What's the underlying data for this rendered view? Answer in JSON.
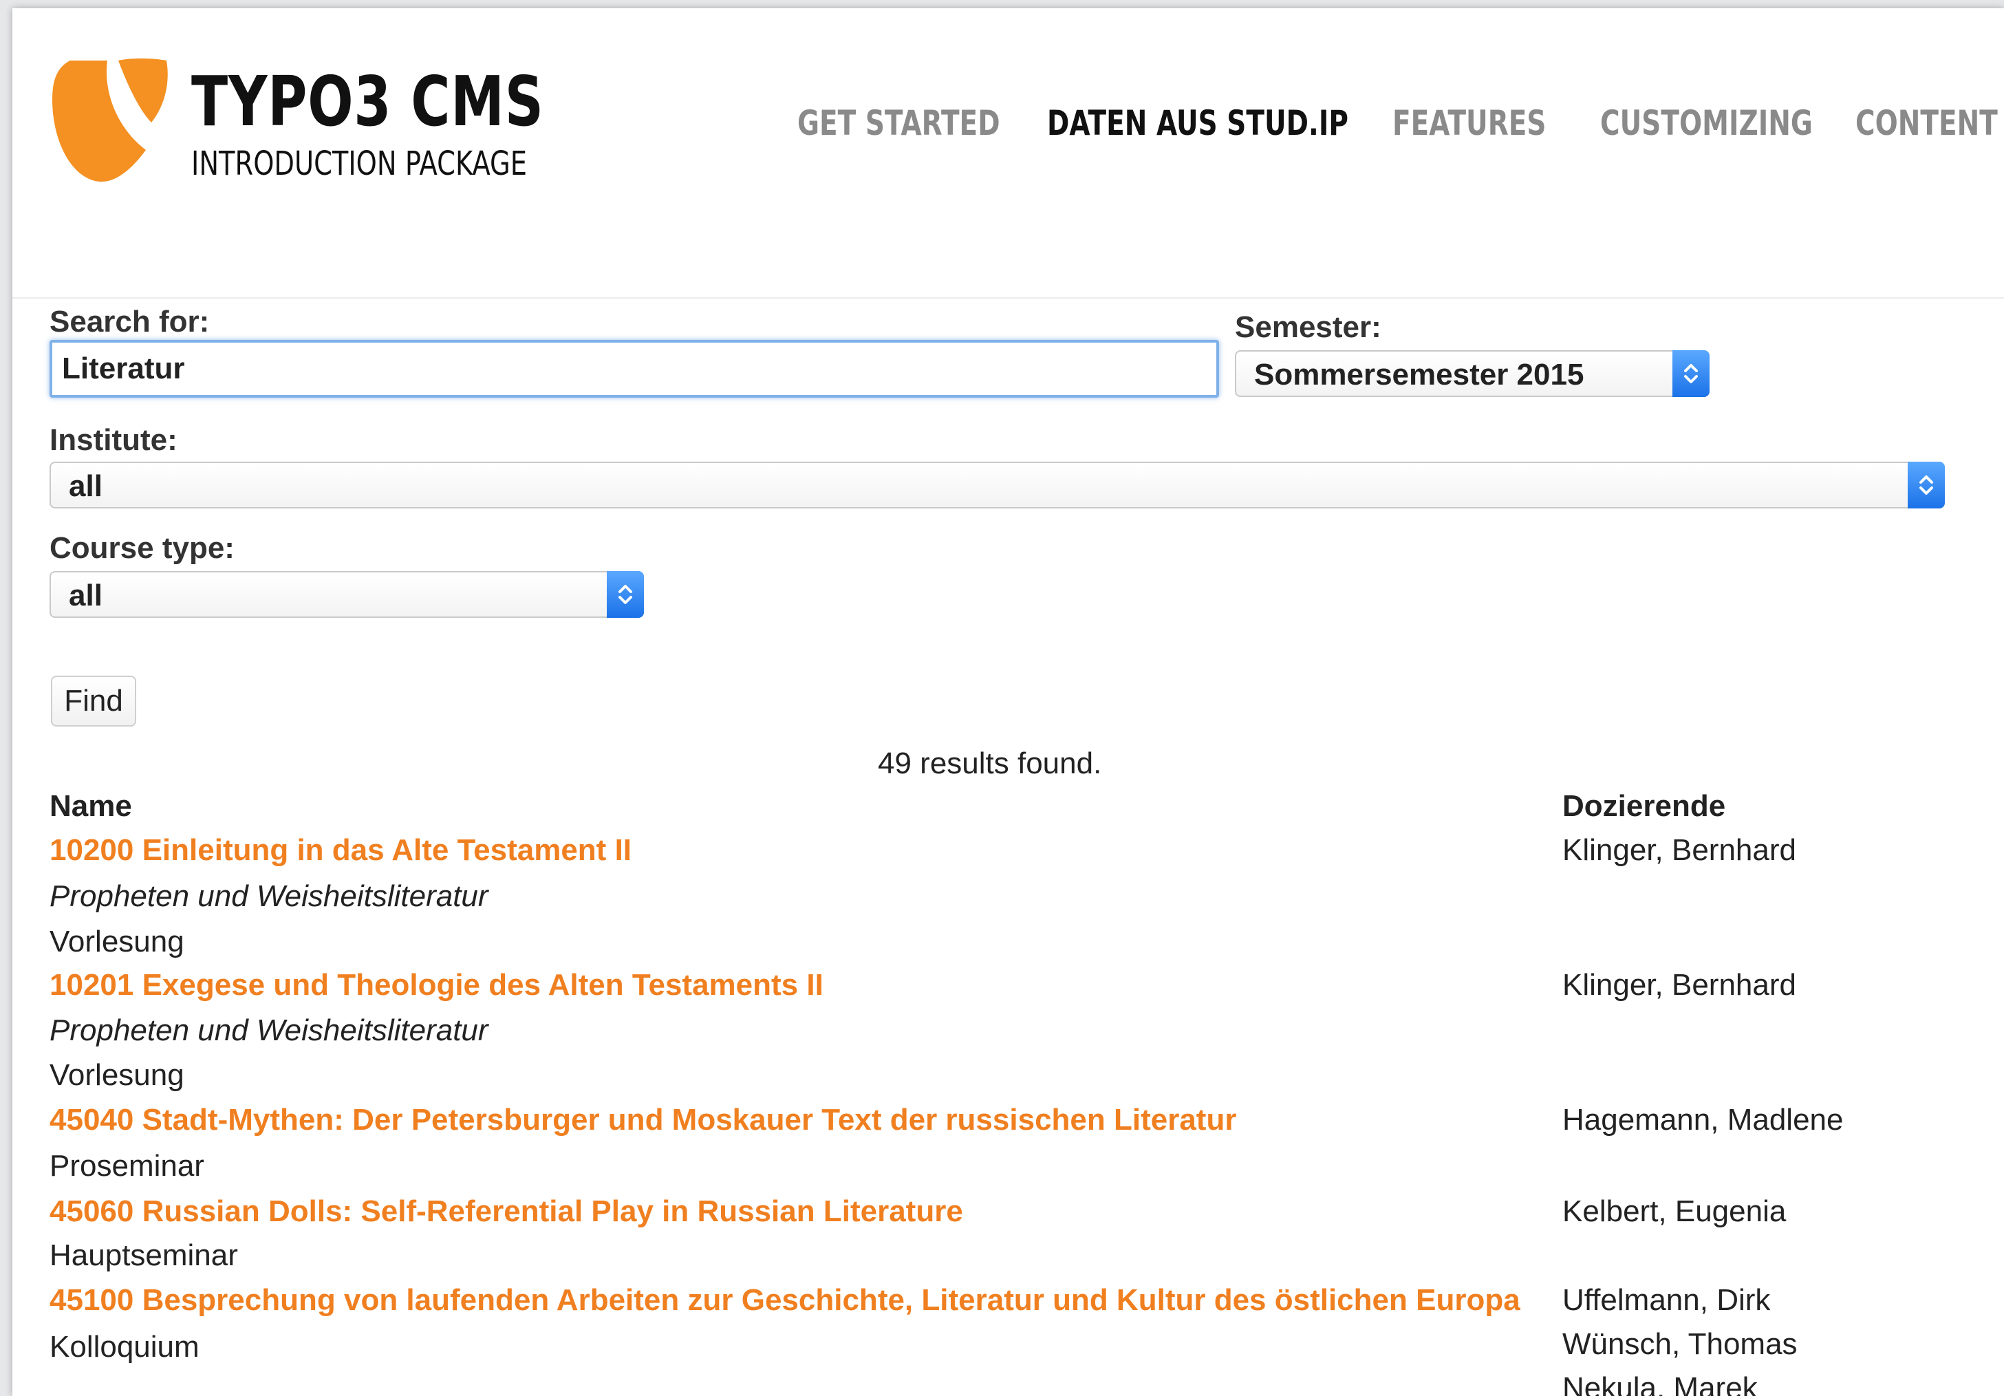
{
  "header": {
    "brand_name": "TYPO3 CMS",
    "brand_sub": "INTRODUCTION PACKAGE",
    "nav": [
      {
        "label": "GET STARTED"
      },
      {
        "label": "DATEN AUS STUD.IP"
      },
      {
        "label": "FEATURES"
      },
      {
        "label": "CUSTOMIZING"
      },
      {
        "label": "CONTENT E"
      }
    ],
    "active_nav": "DATEN AUS STUD.IP"
  },
  "form": {
    "search_label": "Search for:",
    "search_value": "Literatur",
    "semester_label": "Semester:",
    "semester_value": "Sommersemester 2015",
    "institute_label": "Institute:",
    "institute_value": "all",
    "course_type_label": "Course type:",
    "course_type_value": "all",
    "find_label": "Find"
  },
  "results": {
    "count_text": "49 results found.",
    "col_name": "Name",
    "col_lecturers": "Dozierende",
    "rows": [
      {
        "title": "10200 Einleitung in das Alte Testament II",
        "subtitle": "Propheten und Weisheitsliteratur",
        "type": "Vorlesung",
        "lecturers": [
          "Klinger, Bernhard"
        ]
      },
      {
        "title": "10201 Exegese und Theologie des Alten Testaments II",
        "subtitle": "Propheten und Weisheitsliteratur",
        "type": "Vorlesung",
        "lecturers": [
          "Klinger, Bernhard"
        ]
      },
      {
        "title": "45040 Stadt-Mythen: Der Petersburger und Moskauer Text der russischen Literatur",
        "subtitle": "",
        "type": "Proseminar",
        "lecturers": [
          "Hagemann, Madlene"
        ]
      },
      {
        "title": "45060 Russian Dolls: Self-Referential Play in Russian Literature",
        "subtitle": "",
        "type": "Hauptseminar",
        "lecturers": [
          "Kelbert, Eugenia"
        ]
      },
      {
        "title": "45100 Besprechung von laufenden Arbeiten zur Geschichte, Literatur und Kultur des östlichen Europa",
        "subtitle": "",
        "type": "Kolloquium",
        "lecturers": [
          "Uffelmann, Dirk",
          "Wünsch, Thomas",
          "Nekula, Marek"
        ]
      }
    ]
  },
  "colors": {
    "accent_orange": "#f07f20",
    "select_blue": "#1b72e8",
    "focus_blue": "#7fb1e8"
  }
}
